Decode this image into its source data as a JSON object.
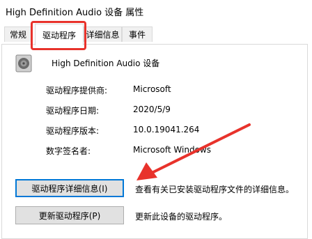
{
  "window": {
    "title": "High Definition Audio 设备 属性"
  },
  "tabs": [
    {
      "label": "常规"
    },
    {
      "label": "驱动程序"
    },
    {
      "label": "详细信息"
    },
    {
      "label": "事件"
    }
  ],
  "device": {
    "name": "High Definition Audio 设备",
    "icon": "speaker-icon"
  },
  "info": {
    "provider_label": "驱动程序提供商:",
    "provider_value": "Microsoft",
    "date_label": "驱动程序日期:",
    "date_value": "2020/5/9",
    "version_label": "驱动程序版本:",
    "version_value": "10.0.19041.264",
    "signer_label": "数字签名者:",
    "signer_value": "Microsoft Windows"
  },
  "buttons": {
    "details_label": "驱动程序详细信息(I)",
    "details_desc": "查看有关已安装驱动程序文件的详细信息。",
    "update_label": "更新驱动程序(P)",
    "update_desc": "更新此设备的驱动程序。"
  },
  "colors": {
    "annotation": "#e8322b",
    "focus": "#0078d7"
  }
}
